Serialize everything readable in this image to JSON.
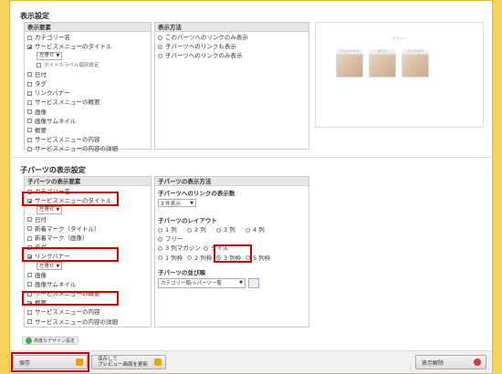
{
  "display_settings": {
    "title": "表示設定",
    "elements_header": "表示要素",
    "elements": [
      {
        "label": "カテゴリー名",
        "checked": false
      },
      {
        "label": "サービスメニューのタイトル",
        "checked": true
      },
      {
        "label": "タイトルラベル個別設定",
        "checked": false
      },
      {
        "label": "日付",
        "checked": false
      },
      {
        "label": "タグ",
        "checked": false
      },
      {
        "label": "リンクバナー",
        "checked": false
      },
      {
        "label": "サービスメニューの概要",
        "checked": false
      },
      {
        "label": "画像",
        "checked": false
      },
      {
        "label": "画像サムネイル",
        "checked": false
      },
      {
        "label": "概要",
        "checked": false
      },
      {
        "label": "サービスメニューの内容",
        "checked": false
      },
      {
        "label": "サービスメニューの内容の詳細",
        "checked": false
      }
    ],
    "title_align": "左寄せ",
    "method_header": "表示方法",
    "methods": [
      {
        "label": "このパーツへのリンクのみ表示",
        "selected": false
      },
      {
        "label": "子パーツへのリンクも表示",
        "selected": true
      },
      {
        "label": "子パーツへのリンクのみ表示",
        "selected": false
      }
    ]
  },
  "preview": {
    "heading": "メニュー",
    "captions": [
      "フェイシャル",
      "ボディ",
      "ヘッドスパ"
    ]
  },
  "child_settings": {
    "title": "子パーツの表示設定",
    "elements_header": "子パーツの表示要素",
    "elements": [
      {
        "label": "カテゴリー名",
        "checked": false
      },
      {
        "label": "サービスメニューのタイトル",
        "checked": true
      },
      {
        "label": "日付",
        "checked": false
      },
      {
        "label": "新着マーク（タイトル）",
        "checked": false
      },
      {
        "label": "新着マーク（画像）",
        "checked": false
      },
      {
        "label": "タグ",
        "checked": false
      },
      {
        "label": "リンクバナー",
        "checked": true
      },
      {
        "label": "画像",
        "checked": false
      },
      {
        "label": "画像サムネイル",
        "checked": false
      },
      {
        "label": "サービスメニューの概要",
        "checked": false
      },
      {
        "label": "概要",
        "checked": true
      },
      {
        "label": "サービスメニューの内容",
        "checked": false
      },
      {
        "label": "サービスメニューの内容の詳細",
        "checked": false
      }
    ],
    "title_align": "左寄せ",
    "banner_align": "左寄せ",
    "method_header": "子パーツの表示方法",
    "link_count_label": "子パーツへのリンクの表示数",
    "link_count_value": "3 件表示",
    "layout_label": "子パーツのレイアウト",
    "layouts": [
      {
        "label": "1 列",
        "selected": false
      },
      {
        "label": "2 列",
        "selected": false
      },
      {
        "label": "3 列",
        "selected": false
      },
      {
        "label": "4 列",
        "selected": false
      },
      {
        "label": "フリー",
        "selected": false
      },
      {
        "label": "3 列マガジン",
        "selected": false
      },
      {
        "label": "タイル",
        "selected": false
      },
      {
        "label": "1 列枠",
        "selected": false
      },
      {
        "label": "2 列枠",
        "selected": false
      },
      {
        "label": "3 列枠",
        "selected": true
      },
      {
        "label": "5 列枠",
        "selected": false
      }
    ],
    "order_label": "子パーツの並び順",
    "order_value": "カテゴリー順->パーツ一覧"
  },
  "advanced_label": "高度なデザイン設定",
  "footer": {
    "save": "保存",
    "save_preview_1": "保存して",
    "save_preview_2": "プレビュー画面を更新",
    "cancel": "表示解除"
  }
}
